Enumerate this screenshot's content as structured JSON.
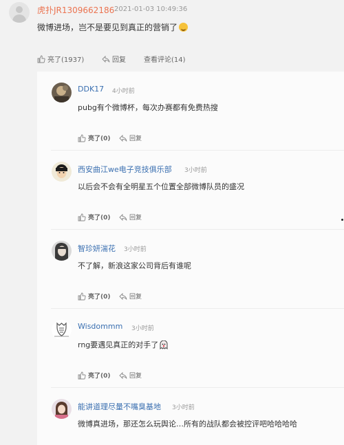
{
  "post": {
    "username": "虎扑JR1309662186",
    "timestamp": "2021-01-03 10:49:36",
    "text": "微博进场，岂不是要见到真正的营销了",
    "like_label": "亮了(1937)",
    "reply_label": "回复",
    "view_comments_label": "查看评论(14)"
  },
  "comments": [
    {
      "username": "DDK17",
      "time": "4小时前",
      "text": "pubg有个微博杯，每次办赛都有免费热搜",
      "like_label": "亮了(0)",
      "reply_label": "回复"
    },
    {
      "username": "西安曲江we电子竞技俱乐部",
      "time": "3小时前",
      "text": "以后会不会有全明星五个位置全部微博队员的盛况",
      "like_label": "亮了(0)",
      "reply_label": "回复"
    },
    {
      "username": "智珍妍湍花",
      "time": "3小时前",
      "text": "不了解，新浪这家公司背后有谁呢",
      "like_label": "亮了(0)",
      "reply_label": "回复"
    },
    {
      "username": "Wisdommm",
      "time": "3小时前",
      "text": "rng要遇见真正的对手了",
      "like_label": "亮了(0)",
      "reply_label": "回复"
    },
    {
      "username": "能讲道理尽量不嘴臭基地",
      "time": "3小时前",
      "text": "微博真进场，那还怎么玩舆论…所有的战队都会被控评吧哈哈哈哈",
      "like_label": "",
      "reply_label": ""
    }
  ],
  "colors": {
    "post_username": "#eb7350",
    "comment_username": "#3a6fb0",
    "page_background": "#f2f2f2",
    "panel_background": "#fbfbfb"
  }
}
